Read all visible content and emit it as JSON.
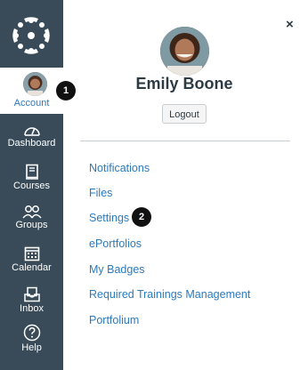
{
  "nav": {
    "account_label": "Account",
    "items": [
      {
        "label": "Dashboard",
        "icon": "dashboard-icon"
      },
      {
        "label": "Courses",
        "icon": "courses-icon"
      },
      {
        "label": "Groups",
        "icon": "groups-icon"
      },
      {
        "label": "Calendar",
        "icon": "calendar-icon"
      },
      {
        "label": "Inbox",
        "icon": "inbox-icon"
      },
      {
        "label": "Help",
        "icon": "help-icon"
      }
    ]
  },
  "tray": {
    "user_name": "Emily Boone",
    "logout_label": "Logout",
    "close_symbol": "×",
    "links": [
      "Notifications",
      "Files",
      "Settings",
      "ePortfolios",
      "My Badges",
      "Required Trainings Management",
      "Portfolium"
    ]
  },
  "callouts": [
    "1",
    "2"
  ],
  "colors": {
    "nav_bg": "#394b58",
    "link": "#2b7abc",
    "text": "#2d3b45"
  }
}
